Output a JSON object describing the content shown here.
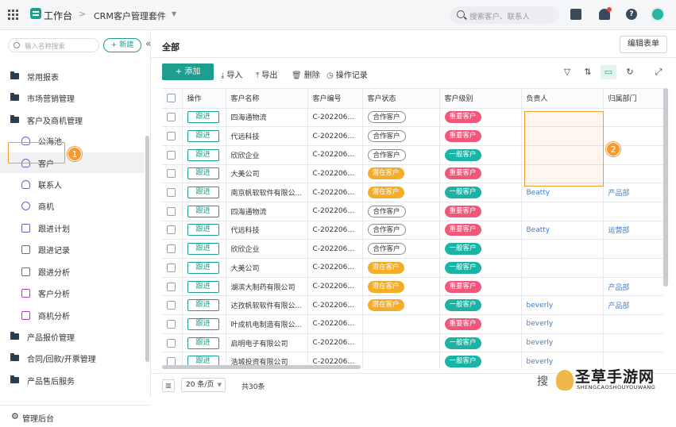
{
  "topbar": {
    "workspace": "工作台",
    "app_name": "CRM客户管理套件",
    "search_placeholder": "搜索客户、联系人"
  },
  "sidebar": {
    "search_placeholder": "输入名称搜索",
    "new_label": "+ 新建",
    "items": [
      {
        "label": "常用报表",
        "type": "folder"
      },
      {
        "label": "市场营销管理",
        "type": "folder"
      },
      {
        "label": "客户及商机管理",
        "type": "folder"
      },
      {
        "label": "公海池",
        "type": "sub"
      },
      {
        "label": "客户",
        "type": "sub"
      },
      {
        "label": "联系人",
        "type": "sub"
      },
      {
        "label": "商机",
        "type": "sub"
      },
      {
        "label": "跟进计划",
        "type": "sub"
      },
      {
        "label": "跟进记录",
        "type": "sub"
      },
      {
        "label": "跟进分析",
        "type": "sub"
      },
      {
        "label": "客户分析",
        "type": "sub"
      },
      {
        "label": "商机分析",
        "type": "sub"
      },
      {
        "label": "产品报价管理",
        "type": "folder"
      },
      {
        "label": "合同/回款/开票管理",
        "type": "folder"
      },
      {
        "label": "产品售后服务",
        "type": "folder"
      }
    ],
    "bottom_label": "管理后台"
  },
  "main": {
    "title": "全部",
    "edit_form": "编辑表单",
    "add_label": "+ 添加",
    "tools": {
      "import": "导入",
      "export": "导出",
      "delete": "删除",
      "log": "操作记录"
    }
  },
  "badges": {
    "one": "1",
    "two": "2"
  },
  "table": {
    "columns": [
      "操作",
      "客户名称",
      "客户编号",
      "客户状态",
      "客户级别",
      "负责人",
      "归属部门"
    ],
    "follow_label": "跟进",
    "rows": [
      {
        "name": "四海通物流",
        "code": "C-20220608...",
        "status": "合作客户",
        "status_type": "coop",
        "level": "重要客户",
        "level_type": "important",
        "owner": "",
        "dept": ""
      },
      {
        "name": "代远科技",
        "code": "C-20220608...",
        "status": "合作客户",
        "status_type": "coop",
        "level": "重要客户",
        "level_type": "important",
        "owner": "",
        "dept": ""
      },
      {
        "name": "欣欣企业",
        "code": "C-20220608...",
        "status": "合作客户",
        "status_type": "coop",
        "level": "一般客户",
        "level_type": "normal",
        "owner": "",
        "dept": ""
      },
      {
        "name": "大美公司",
        "code": "C-20220608...",
        "status": "潜在客户",
        "status_type": "potential",
        "level": "重要客户",
        "level_type": "important",
        "owner": "",
        "dept": ""
      },
      {
        "name": "南京帆软软件有限公...",
        "code": "C-20220608...",
        "status": "潜在客户",
        "status_type": "potential",
        "level": "一般客户",
        "level_type": "normal",
        "owner": "Beatty",
        "dept": "产品部"
      },
      {
        "name": "四海通物流",
        "code": "C-20220608...",
        "status": "合作客户",
        "status_type": "coop",
        "level": "重要客户",
        "level_type": "important",
        "owner": "",
        "dept": ""
      },
      {
        "name": "代远科技",
        "code": "C-20220608...",
        "status": "合作客户",
        "status_type": "coop",
        "level": "重要客户",
        "level_type": "important",
        "owner": "Beatty",
        "dept": "运营部"
      },
      {
        "name": "欣欣企业",
        "code": "C-20220608...",
        "status": "合作客户",
        "status_type": "coop",
        "level": "一般客户",
        "level_type": "normal",
        "owner": "",
        "dept": ""
      },
      {
        "name": "大美公司",
        "code": "C-20220608...",
        "status": "潜在客户",
        "status_type": "potential",
        "level": "一般客户",
        "level_type": "normal",
        "owner": "",
        "dept": ""
      },
      {
        "name": "湖滨大制药有限公司",
        "code": "C-20220607...",
        "status": "潜在客户",
        "status_type": "potential",
        "level": "重要客户",
        "level_type": "important",
        "owner": "",
        "dept": "产品部"
      },
      {
        "name": "达孜帆软软件有限公...",
        "code": "C-20220607...",
        "status": "潜在客户",
        "status_type": "potential",
        "level": "一般客户",
        "level_type": "normal",
        "owner": "beverly",
        "dept": "产品部"
      },
      {
        "name": "叶成机电制造有限公...",
        "code": "C-20220602...",
        "status": "",
        "status_type": "",
        "level": "重要客户",
        "level_type": "important",
        "owner": "beverly",
        "dept": ""
      },
      {
        "name": "启明电子有限公司",
        "code": "C-20220602...",
        "status": "",
        "status_type": "",
        "level": "一般客户",
        "level_type": "normal",
        "owner": "beverly",
        "dept": ""
      },
      {
        "name": "浩城投资有限公司",
        "code": "C-20220602...",
        "status": "",
        "status_type": "",
        "level": "一般客户",
        "level_type": "normal",
        "owner": "beverly",
        "dept": ""
      }
    ]
  },
  "footer": {
    "page_size": "20 条/页",
    "total": "共30条"
  },
  "watermark": {
    "title": "圣草手游网",
    "sub": "SHENGCAOSHOUYOUWANG",
    "pre": "搜",
    "tail": "号"
  },
  "colors": {
    "accent": "#1e9e8c",
    "highlight": "#f29b33",
    "important": "#f0577a",
    "potential": "#f3ad2a",
    "normal": "#1ab3a6"
  }
}
